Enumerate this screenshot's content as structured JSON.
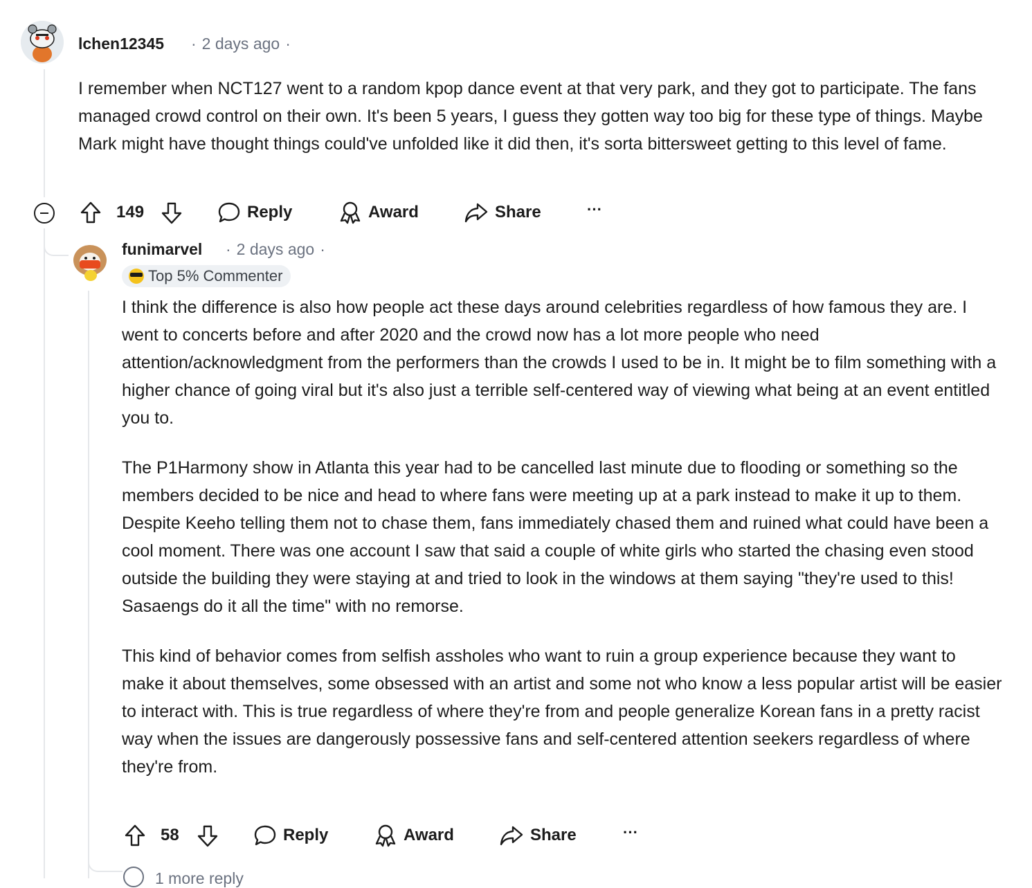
{
  "comment1": {
    "username": "lchen12345",
    "time": "2 days ago",
    "body": "I remember when NCT127 went to a random kpop dance event at that very park, and they got to participate. The fans managed crowd control on their own. It's been 5 years, I guess they gotten way too big for these type of things. Maybe Mark might have thought things could've unfolded like it did then, it's sorta bittersweet getting to this level of fame.",
    "votes": "149",
    "reply_label": "Reply",
    "award_label": "Award",
    "share_label": "Share",
    "more_label": "···"
  },
  "comment2": {
    "username": "funimarvel",
    "time": "2 days ago",
    "badge": "Top 5% Commenter",
    "paragraphs": [
      "I think the difference is also how people act these days around celebrities regardless of how famous they are. I went to concerts before and after 2020 and the crowd now has a lot more people who need attention/acknowledgment from the performers than the crowds I used to be in. It might be to film something with a higher chance of going viral but it's also just a terrible self-centered way of viewing what being at an event entitled you to.",
      "The P1Harmony show in Atlanta this year had to be cancelled last minute due to flooding or something so the members decided to be nice and head to where fans were meeting up at a park instead to make it up to them. Despite Keeho telling them not to chase them, fans immediately chased them and ruined what could have been a cool moment. There was one account I saw that said a couple of white girls who started the chasing even stood outside the building they were staying at and tried to look in the windows at them saying \"they're used to this! Sasaengs do it all the time\" with no remorse.",
      "This kind of behavior comes from selfish assholes who want to ruin a group experience because they want to make it about themselves, some obsessed with an artist and some not who know a less popular artist will be easier to interact with. This is true regardless of where they're from and people generalize Korean fans in a pretty racist way when the issues are dangerously possessive fans and self-centered attention seekers regardless of where they're from."
    ],
    "votes": "58",
    "reply_label": "Reply",
    "award_label": "Award",
    "share_label": "Share",
    "more_label": "···"
  },
  "more_replies": "1 more reply",
  "icons": {
    "upvote": "arrow-up-icon",
    "downvote": "arrow-down-icon",
    "reply": "speech-bubble-icon",
    "award": "award-ribbon-icon",
    "share": "share-arrow-icon",
    "collapse": "minus-circle-icon"
  },
  "colors": {
    "text": "#1c1c1c",
    "meta": "#6b7280",
    "thread_line": "#e5e7ea",
    "badge_bg": "#eef1f4"
  }
}
